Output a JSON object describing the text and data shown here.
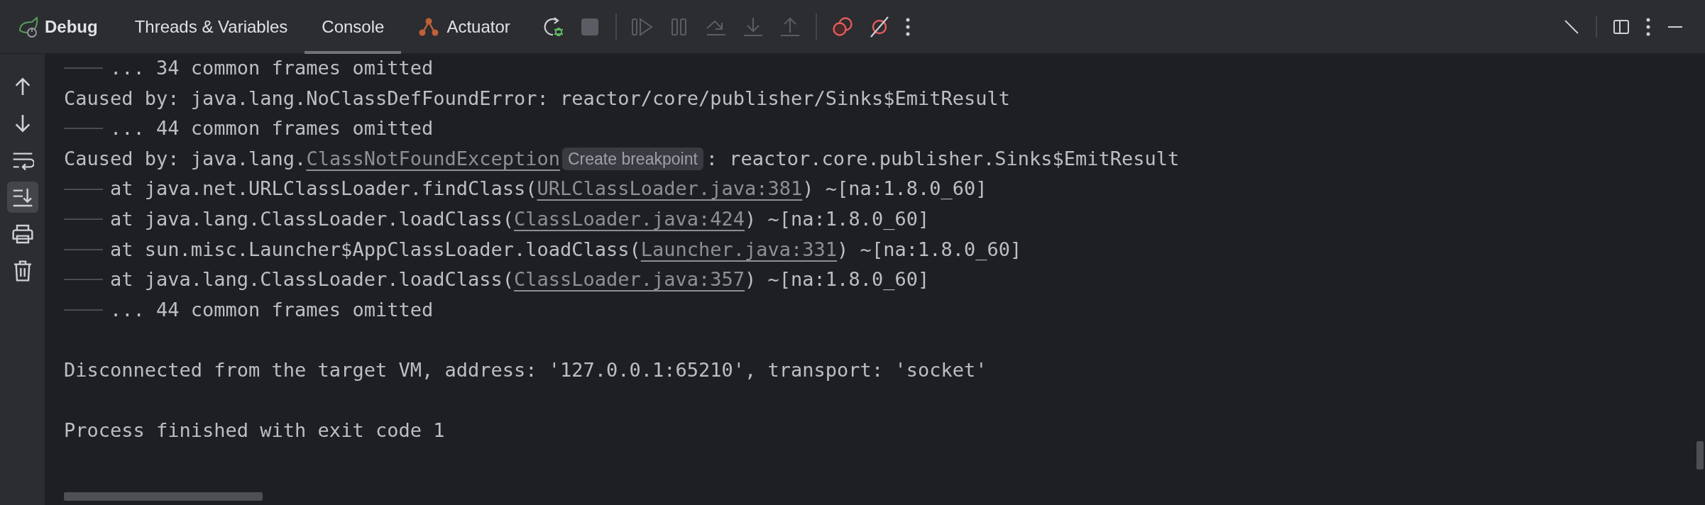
{
  "toolbar": {
    "title": "Debug",
    "tabs": [
      {
        "label": "Threads & Variables",
        "selected": false,
        "kind": "plain"
      },
      {
        "label": "Console",
        "selected": true,
        "kind": "plain"
      },
      {
        "label": "Actuator",
        "selected": false,
        "kind": "actuator"
      }
    ]
  },
  "sidebar": {
    "soft_wrap": false,
    "scroll_to_end": true
  },
  "console": {
    "lines": [
      {
        "kind": "text",
        "tab": true,
        "segments": [
          {
            "kind": "plain",
            "text": "... 34 common frames omitted"
          }
        ]
      },
      {
        "kind": "text",
        "tab": false,
        "segments": [
          {
            "kind": "plain",
            "text": "Caused by: java.lang.NoClassDefFoundError: reactor/core/publisher/Sinks$EmitResult"
          }
        ]
      },
      {
        "kind": "text",
        "tab": true,
        "segments": [
          {
            "kind": "plain",
            "text": "... 44 common frames omitted"
          }
        ]
      },
      {
        "kind": "text",
        "tab": false,
        "segments": [
          {
            "kind": "plain",
            "text": "Caused by: java.lang."
          },
          {
            "kind": "link",
            "text": "ClassNotFoundException"
          },
          {
            "kind": "hint",
            "text": "Create breakpoint"
          },
          {
            "kind": "plain",
            "text": ": reactor.core.publisher.Sinks$EmitResult"
          }
        ]
      },
      {
        "kind": "text",
        "tab": true,
        "segments": [
          {
            "kind": "plain",
            "text": "at java.net.URLClassLoader.findClass("
          },
          {
            "kind": "link",
            "text": "URLClassLoader.java:381"
          },
          {
            "kind": "plain",
            "text": ") ~[na:1.8.0_60]"
          }
        ]
      },
      {
        "kind": "text",
        "tab": true,
        "segments": [
          {
            "kind": "plain",
            "text": "at java.lang.ClassLoader.loadClass("
          },
          {
            "kind": "link",
            "text": "ClassLoader.java:424"
          },
          {
            "kind": "plain",
            "text": ") ~[na:1.8.0_60]"
          }
        ]
      },
      {
        "kind": "text",
        "tab": true,
        "segments": [
          {
            "kind": "plain",
            "text": "at sun.misc.Launcher$AppClassLoader.loadClass("
          },
          {
            "kind": "link",
            "text": "Launcher.java:331"
          },
          {
            "kind": "plain",
            "text": ") ~[na:1.8.0_60]"
          }
        ]
      },
      {
        "kind": "text",
        "tab": true,
        "segments": [
          {
            "kind": "plain",
            "text": "at java.lang.ClassLoader.loadClass("
          },
          {
            "kind": "link",
            "text": "ClassLoader.java:357"
          },
          {
            "kind": "plain",
            "text": ") ~[na:1.8.0_60]"
          }
        ]
      },
      {
        "kind": "text",
        "tab": true,
        "segments": [
          {
            "kind": "plain",
            "text": "... 44 common frames omitted"
          }
        ]
      },
      {
        "kind": "blank"
      },
      {
        "kind": "text",
        "tab": false,
        "segments": [
          {
            "kind": "plain",
            "text": "Disconnected from the target VM, address: '127.0.0.1:65210', transport: 'socket'"
          }
        ]
      },
      {
        "kind": "blank"
      },
      {
        "kind": "text",
        "tab": false,
        "segments": [
          {
            "kind": "plain",
            "text": "Process finished with exit code 1"
          }
        ]
      }
    ]
  }
}
